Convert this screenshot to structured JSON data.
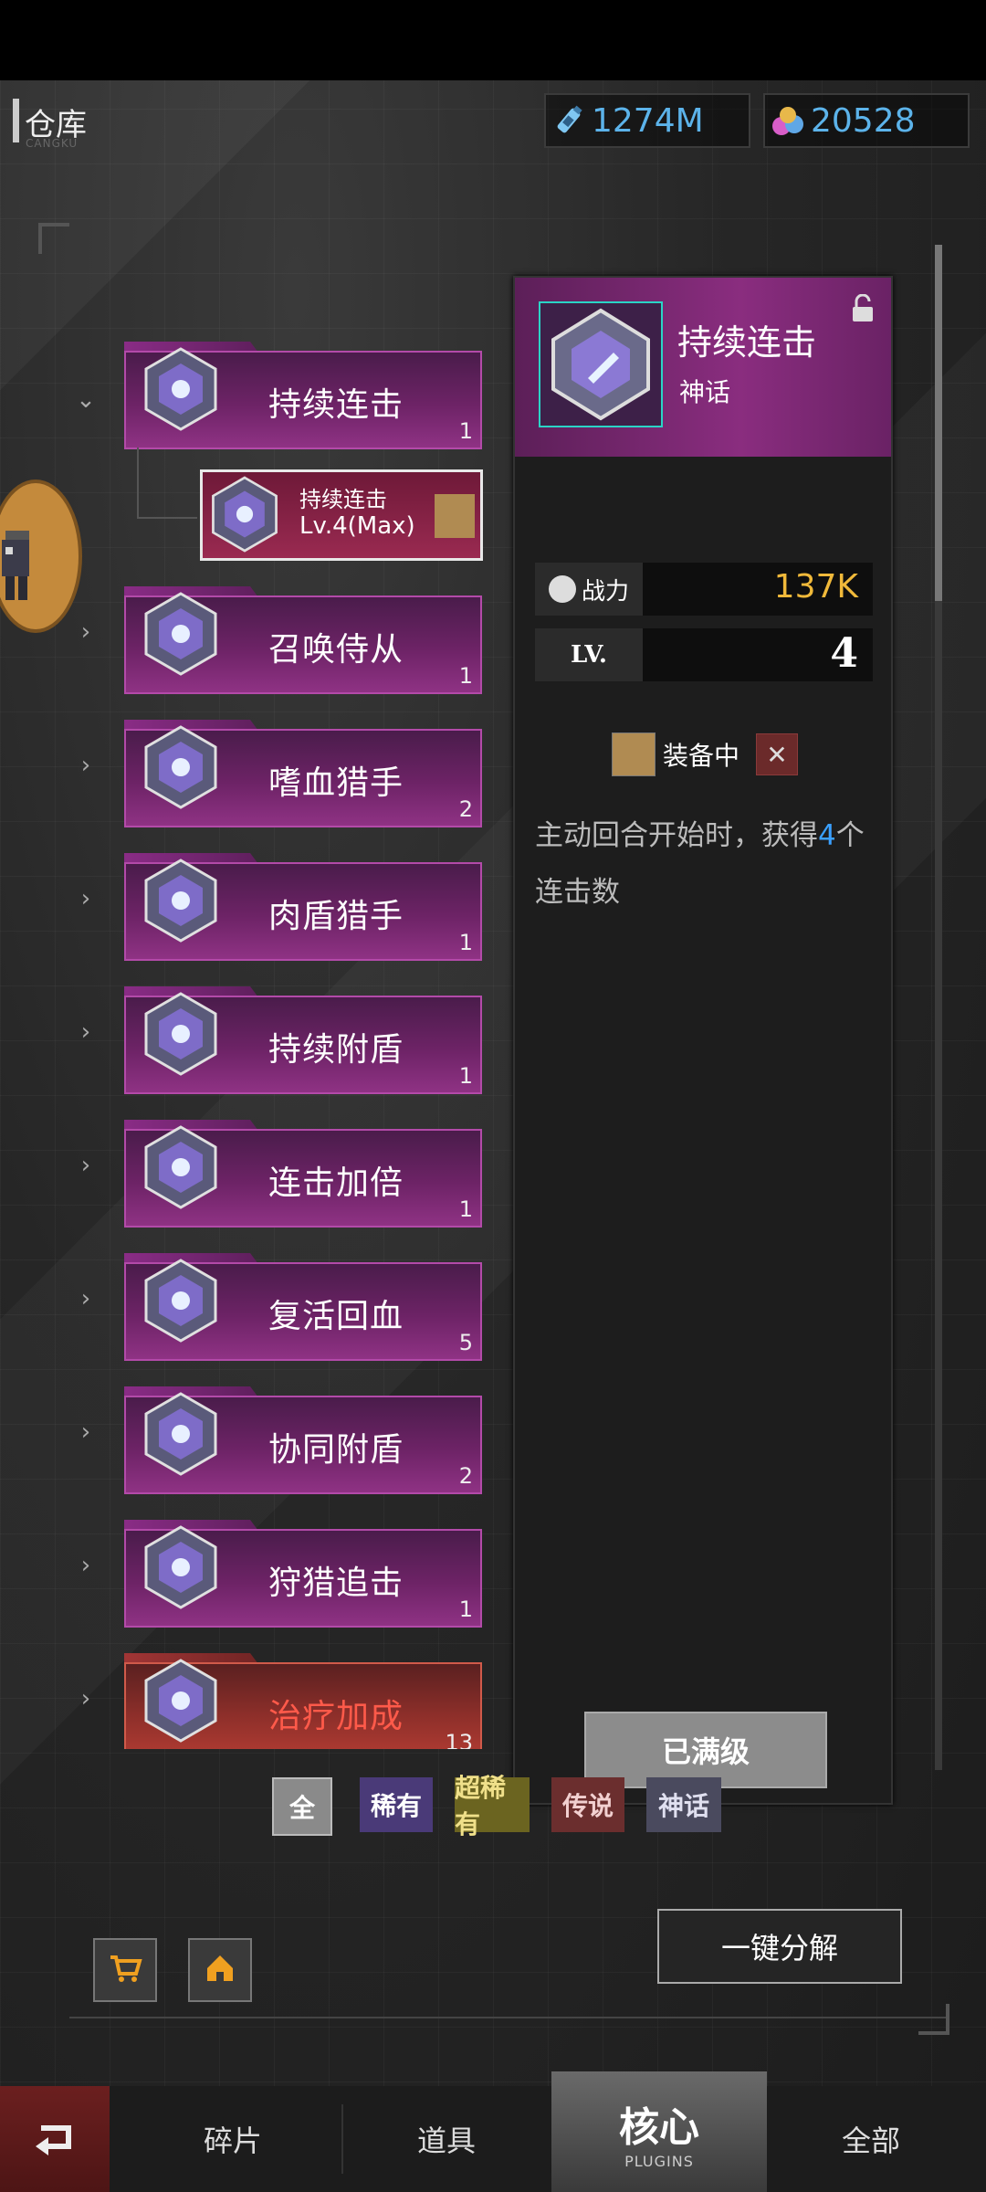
{
  "header": {
    "title": "仓库",
    "subtitle": "CANGKU"
  },
  "resources": [
    {
      "icon": "fuel-bottle-icon",
      "value": "1274M"
    },
    {
      "icon": "gem-pile-icon",
      "value": "20528"
    }
  ],
  "list": [
    {
      "name": "持续连击",
      "count": "1",
      "rarity": "myth",
      "expanded": true
    },
    {
      "name": "召唤侍从",
      "count": "1",
      "rarity": "myth"
    },
    {
      "name": "嗜血猎手",
      "count": "2",
      "rarity": "myth"
    },
    {
      "name": "肉盾猎手",
      "count": "1",
      "rarity": "myth"
    },
    {
      "name": "持续附盾",
      "count": "1",
      "rarity": "myth"
    },
    {
      "name": "连击加倍",
      "count": "1",
      "rarity": "myth"
    },
    {
      "name": "复活回血",
      "count": "5",
      "rarity": "myth"
    },
    {
      "name": "协同附盾",
      "count": "2",
      "rarity": "myth"
    },
    {
      "name": "狩猎追击",
      "count": "1",
      "rarity": "myth"
    },
    {
      "name": "治疗加成",
      "count": "13",
      "rarity": "legend"
    },
    {
      "name": "",
      "count": "",
      "rarity": "legend"
    }
  ],
  "sub_item": {
    "name": "持续连击",
    "level": "Lv.4(Max)"
  },
  "detail": {
    "name": "持续连击",
    "rarity": "神话",
    "power_label": "战力",
    "power_value": "137K",
    "level_label": "LV.",
    "level_value": "4",
    "equipped_label": "装备中",
    "desc_before": "主动回合开始时，获得",
    "desc_highlight": "4",
    "desc_after": "个连击数",
    "max_button": "已满级"
  },
  "filters": [
    "全",
    "稀有",
    "超稀有",
    "传说",
    "神话"
  ],
  "decompose_button": "一键分解",
  "bottom_nav": {
    "tabs": [
      "碎片",
      "道具",
      "核心",
      "全部"
    ],
    "active_sub": "PLUGINS"
  },
  "colors": {
    "myth": "#8a2d7f",
    "legend": "#b23c33",
    "accent_blue": "#5cb3ea",
    "power": "#f0b93a"
  }
}
